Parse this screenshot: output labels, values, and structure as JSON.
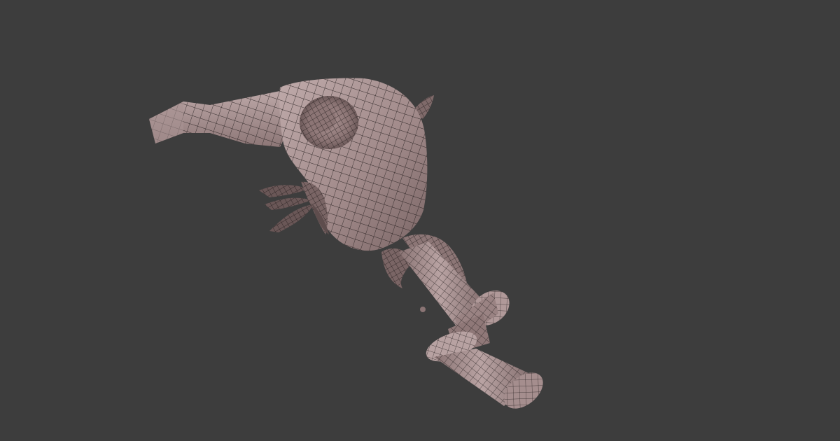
{
  "viewport": {
    "background_color": "#3d3d3d",
    "display_mode": "wireframe-over-solid",
    "object": {
      "name": "",
      "surface_color": "#9c8585",
      "shadow_color": "#6f5c5c",
      "highlight_color": "#c3adad",
      "wire_color": "#1c1616"
    }
  }
}
